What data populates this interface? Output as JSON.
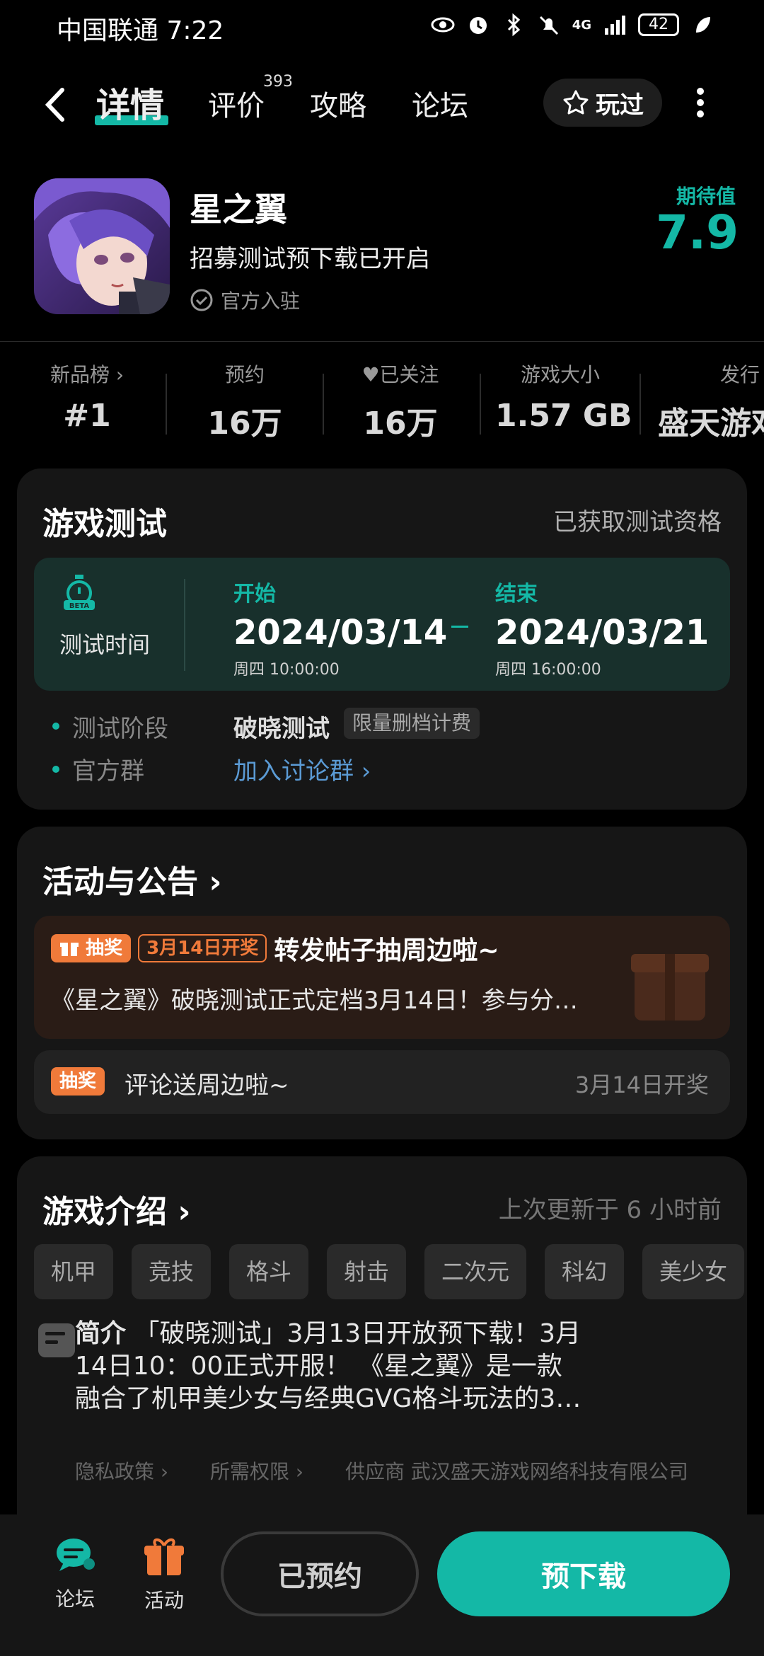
{
  "status_bar": {
    "carrier_time": "中国联通 7:22",
    "network": "4G",
    "battery": "42"
  },
  "nav": {
    "tabs": [
      {
        "label": "详情",
        "active": true
      },
      {
        "label": "评价",
        "badge": "393"
      },
      {
        "label": "攻略"
      },
      {
        "label": "论坛"
      }
    ],
    "played_label": "玩过"
  },
  "game": {
    "title": "星之翼",
    "subtitle": "招募测试预下载已开启",
    "official": "官方入驻",
    "expect_label": "期待值",
    "expect_value": "7.9"
  },
  "stats": [
    {
      "label": "新品榜",
      "value": "#1"
    },
    {
      "label": "预约",
      "value": "16万"
    },
    {
      "label": "已关注",
      "value": "16万"
    },
    {
      "label": "游戏大小",
      "value": "1.57 GB"
    },
    {
      "label": "发行",
      "value": "盛天游戏"
    }
  ],
  "test_card": {
    "title": "游戏测试",
    "qualification": "已获取测试资格",
    "time_label": "测试时间",
    "start_label": "开始",
    "start_date": "2024/03/14",
    "start_time": "周四  10:00:00",
    "end_label": "结束",
    "end_date": "2024/03/21",
    "end_time": "周四  16:00:00",
    "stage_label": "测试阶段",
    "stage_value": "破晓测试",
    "stage_tag": "限量删档计费",
    "group_label": "官方群",
    "group_link": "加入讨论群 ›"
  },
  "activity_card": {
    "title": "活动与公告 ›",
    "items": [
      {
        "tag": "抽奖",
        "date_tag": "3月14日开奖",
        "headline": "转发帖子抽周边啦~",
        "desc": "《星之翼》破晓测试正式定档3月14日！参与分…"
      },
      {
        "tag": "抽奖",
        "headline": "评论送周边啦~",
        "right": "3月14日开奖"
      }
    ]
  },
  "intro_card": {
    "title": "游戏介绍 ›",
    "updated": "上次更新于 6 小时前",
    "chips": [
      "机甲",
      "竞技",
      "格斗",
      "射击",
      "二次元",
      "科幻",
      "美少女"
    ],
    "desc_label": "简介",
    "desc_line1": "「破晓测试」3月13日开放预下载！3月",
    "desc_line2": "14日10：00正式开服！ 《星之翼》是一款",
    "desc_line3": "融合了机甲美少女与经典GVG格斗玩法的3…",
    "links": [
      "隐私政策 ›",
      "所需权限 ›",
      "供应商 武汉盛天游戏网络科技有限公司"
    ]
  },
  "bottom_bar": {
    "forum": "论坛",
    "activity": "活动",
    "reserved": "已预约",
    "download": "预下载"
  },
  "colors": {
    "accent": "#14b8a6",
    "prize": "#f07a3a",
    "link": "#5b9bd5"
  }
}
